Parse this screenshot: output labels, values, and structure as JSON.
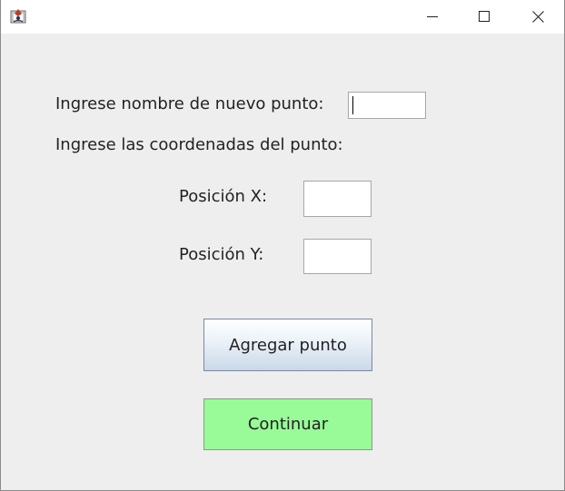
{
  "window": {
    "title": "",
    "app_icon": "java-app-icon",
    "controls": {
      "minimize": "minimize-icon",
      "maximize": "maximize-icon",
      "close": "close-icon"
    }
  },
  "form": {
    "name_label": "Ingrese nombre de nuevo punto:",
    "name_value": "",
    "coords_label": "Ingrese las coordenadas del punto:",
    "x_label": "Posición X:",
    "x_value": "",
    "y_label": "Posición Y:",
    "y_value": ""
  },
  "buttons": {
    "add_label": "Agregar punto",
    "continue_label": "Continuar"
  },
  "colors": {
    "background": "#eeeeee",
    "continue_button": "#98fb98",
    "add_button_gradient_bottom": "#c9d8e8"
  }
}
